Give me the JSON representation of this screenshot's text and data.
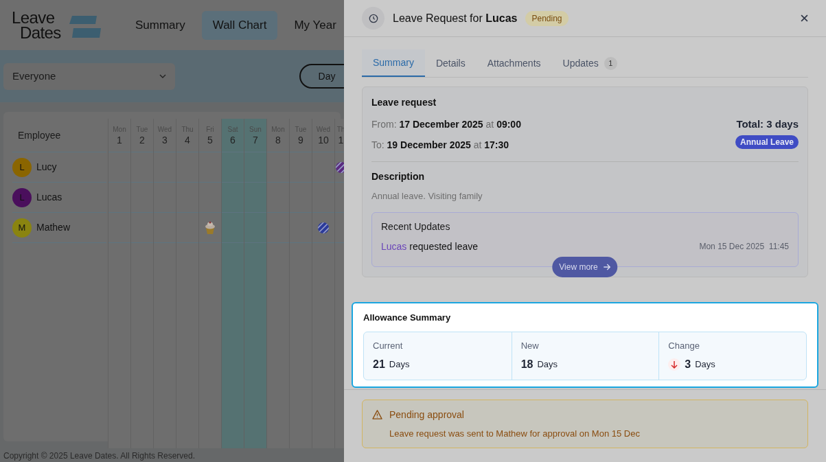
{
  "app": {
    "logo": [
      "Leave",
      "Dates"
    ],
    "nav": [
      {
        "label": "Summary",
        "selected": false
      },
      {
        "label": "Wall Chart",
        "selected": true
      },
      {
        "label": "My Year",
        "selected": false
      }
    ],
    "filter": {
      "value": "Everyone"
    },
    "view_buttons": [
      {
        "label": "Day",
        "selected": true
      }
    ],
    "wall_chart": {
      "employee_header": "Employee",
      "days": [
        {
          "weekday": "Mon",
          "date": "1",
          "weekend": false
        },
        {
          "weekday": "Tue",
          "date": "2",
          "weekend": false
        },
        {
          "weekday": "Wed",
          "date": "3",
          "weekend": false
        },
        {
          "weekday": "Thu",
          "date": "4",
          "weekend": false
        },
        {
          "weekday": "Fri",
          "date": "5",
          "weekend": false
        },
        {
          "weekday": "Sat",
          "date": "6",
          "weekend": true
        },
        {
          "weekday": "Sun",
          "date": "7",
          "weekend": true
        },
        {
          "weekday": "Mon",
          "date": "8",
          "weekend": false
        },
        {
          "weekday": "Tue",
          "date": "9",
          "weekend": false
        },
        {
          "weekday": "Wed",
          "date": "10",
          "weekend": false
        },
        {
          "weekday": "Th",
          "date": "1",
          "weekend": false
        }
      ],
      "employees": [
        {
          "name": "Lucy",
          "initial": "L",
          "color": "#8a6500",
          "cells": [
            {
              "kind": "none"
            },
            {
              "kind": "none"
            },
            {
              "kind": "none"
            },
            {
              "kind": "none"
            },
            {
              "kind": "none"
            },
            {
              "kind": "none"
            },
            {
              "kind": "none"
            },
            {
              "kind": "none"
            },
            {
              "kind": "none"
            },
            {
              "kind": "none"
            },
            {
              "kind": "leave",
              "color": "#5a2a80"
            }
          ]
        },
        {
          "name": "Lucas",
          "initial": "L",
          "color": "#4a0f5c",
          "cells": [
            {
              "kind": "none"
            },
            {
              "kind": "none"
            },
            {
              "kind": "none"
            },
            {
              "kind": "none"
            },
            {
              "kind": "none"
            },
            {
              "kind": "none"
            },
            {
              "kind": "none"
            },
            {
              "kind": "none"
            },
            {
              "kind": "none"
            },
            {
              "kind": "none"
            },
            {
              "kind": "none"
            }
          ]
        },
        {
          "name": "Mathew",
          "initial": "M",
          "color": "#8a8410",
          "cells": [
            {
              "kind": "none"
            },
            {
              "kind": "none"
            },
            {
              "kind": "none"
            },
            {
              "kind": "none"
            },
            {
              "kind": "birthday"
            },
            {
              "kind": "none"
            },
            {
              "kind": "none"
            },
            {
              "kind": "none"
            },
            {
              "kind": "none"
            },
            {
              "kind": "leave",
              "color": "#2b3a9a"
            },
            {
              "kind": "none"
            }
          ]
        }
      ]
    },
    "footer": "Copyright © 2025 Leave Dates. All Rights Reserved."
  },
  "panel": {
    "title": "Leave Request for **Lucas**",
    "status": "Pending",
    "tabs": [
      {
        "label": "Summary",
        "selected": true
      },
      {
        "label": "Details",
        "selected": false
      },
      {
        "label": "Attachments",
        "selected": false
      },
      {
        "label": "Updates",
        "selected": false,
        "count": "1"
      }
    ],
    "leave_request": {
      "heading": "Leave request",
      "from": "From: **17 December 2025** at **09:00**",
      "to": "To: **19 December 2025** at **17:30**",
      "total": "Total: 3 days",
      "type": "Annual Leave",
      "description_heading": "Description",
      "description": "Annual leave. Visiting family"
    },
    "recent_updates": {
      "heading": "Recent Updates",
      "items": [
        {
          "actor": "Lucas",
          "action": "requested leave",
          "time": "Mon 15 Dec 2025  11:45"
        }
      ],
      "button": "View more"
    },
    "allowance": {
      "heading": "Allowance Summary",
      "stats": [
        {
          "label": "Current",
          "value": "21",
          "unit": "Days",
          "kind": "plain"
        },
        {
          "label": "New",
          "value": "18",
          "unit": "Days",
          "kind": "plain"
        },
        {
          "label": "Change",
          "value": "3",
          "unit": "Days",
          "kind": "decrease"
        }
      ]
    },
    "alert": {
      "title": "Pending approval",
      "message": "Leave request was sent to Mathew for approval on Mon 15 Dec"
    }
  }
}
